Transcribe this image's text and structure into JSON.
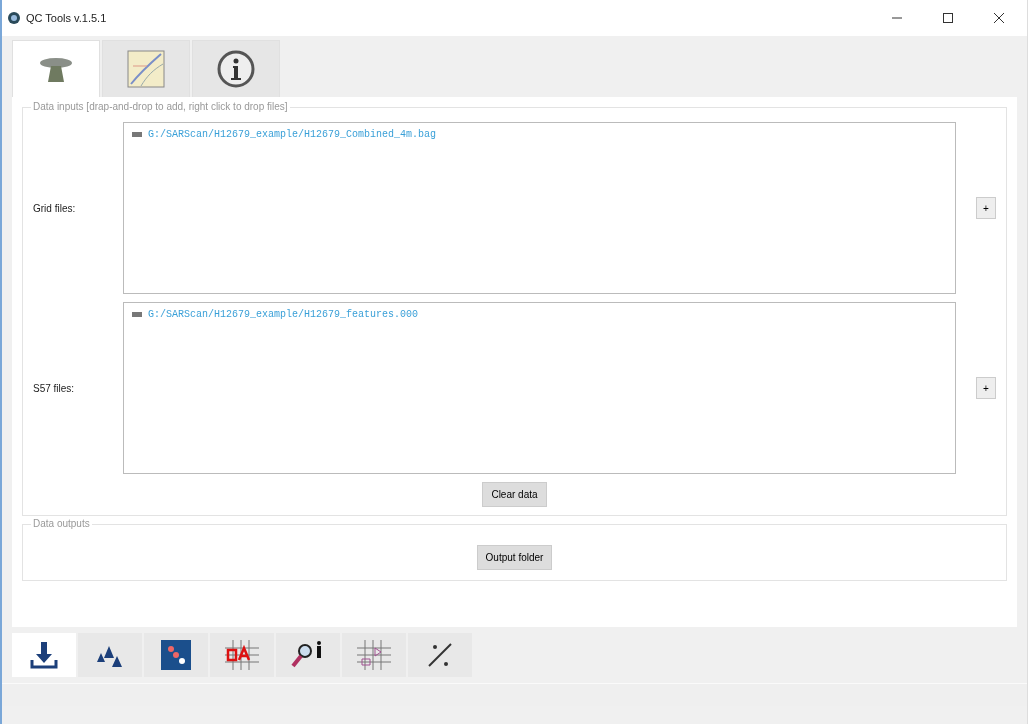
{
  "window": {
    "title": "QC Tools v.1.5.1"
  },
  "top_tabs": [
    {
      "kind": "survey",
      "selected": true
    },
    {
      "kind": "chart",
      "selected": false
    },
    {
      "kind": "info",
      "selected": false
    }
  ],
  "data_inputs": {
    "title": "Data inputs  [drap-and-drop to add, right click to drop files]",
    "rows": [
      {
        "label": "Grid files:",
        "files": [
          "G:/SARScan/H12679_example/H12679_Combined_4m.bag"
        ],
        "button": "+"
      },
      {
        "label": "S57 files:",
        "files": [
          "G:/SARScan/H12679_example/H12679_features.000"
        ],
        "button": "+"
      }
    ],
    "clear_button": "Clear data"
  },
  "data_outputs": {
    "title": "Data outputs",
    "button": "Output folder"
  },
  "bottom_tabs": [
    {
      "kind": "download",
      "selected": true
    },
    {
      "kind": "triangles",
      "selected": false
    },
    {
      "kind": "map",
      "selected": false
    },
    {
      "kind": "qa",
      "selected": false
    },
    {
      "kind": "probe",
      "selected": false
    },
    {
      "kind": "grid",
      "selected": false
    },
    {
      "kind": "scy",
      "selected": false
    }
  ]
}
